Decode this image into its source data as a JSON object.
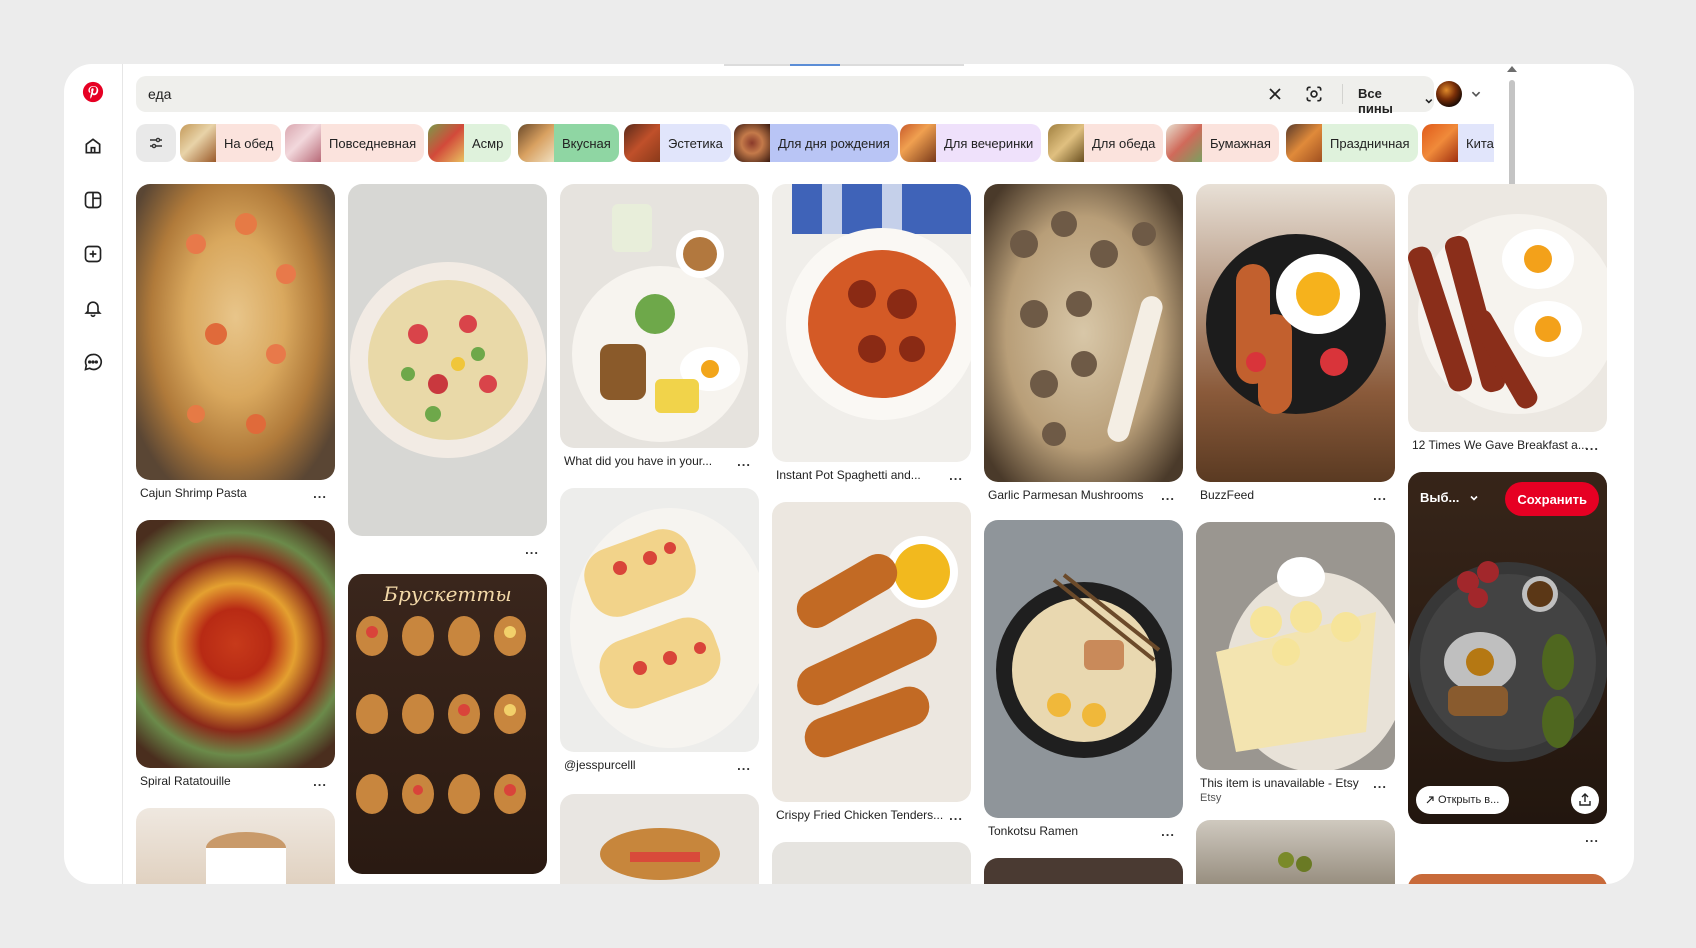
{
  "search": {
    "query": "еда",
    "filter_label": "Все пины"
  },
  "chips": [
    {
      "label": "На обед",
      "bg": "#fbe3dd"
    },
    {
      "label": "Повседневная",
      "bg": "#fbe3dd"
    },
    {
      "label": "Асмр",
      "bg": "#dff2dc"
    },
    {
      "label": "Вкусная",
      "bg": "#8fd6a3"
    },
    {
      "label": "Эстетика",
      "bg": "#e1e5fb"
    },
    {
      "label": "Для дня рождения",
      "bg": "#b9c5f5"
    },
    {
      "label": "Для вечеринки",
      "bg": "#efe1fb"
    },
    {
      "label": "Для обеда",
      "bg": "#fbe3dd"
    },
    {
      "label": "Бумажная",
      "bg": "#fbe3dd"
    },
    {
      "label": "Праздничная",
      "bg": "#dff2dc"
    },
    {
      "label": "Китай",
      "bg": "#e1e5fb"
    }
  ],
  "pins": {
    "p1": {
      "title": "Cajun Shrimp Pasta",
      "more": "..."
    },
    "p2": {
      "title": "Spiral Ratatouille",
      "more": "..."
    },
    "p4": {
      "more": "..."
    },
    "p5_image_text": "Брускетты",
    "p6": {
      "title": "What did you have in your...",
      "more": "..."
    },
    "p7": {
      "title": "@jesspurcelll",
      "more": "..."
    },
    "p9": {
      "title": "Instant Pot Spaghetti and...",
      "more": "..."
    },
    "p10": {
      "title": "Crispy Fried Chicken Tenders...",
      "more": "..."
    },
    "p12": {
      "title": "Garlic Parmesan Mushrooms",
      "more": "..."
    },
    "p13": {
      "title": "Tonkotsu Ramen",
      "more": "..."
    },
    "p15": {
      "title": "BuzzFeed",
      "more": "..."
    },
    "p16": {
      "title": "This item is unavailable - Etsy",
      "sub": "Etsy",
      "more": "..."
    },
    "p18": {
      "title": "12 Times We Gave Breakfast a...",
      "more": "..."
    },
    "p19": {
      "board": "Выб...",
      "save": "Сохранить",
      "open": "Открыть в...",
      "more": "..."
    }
  },
  "icons": [
    "pinterest-logo",
    "home-icon",
    "explore-icon",
    "create-icon",
    "bell-icon",
    "messages-icon",
    "close-icon",
    "camera-search-icon",
    "chevron-down-icon",
    "filter-sliders-icon",
    "share-icon",
    "arrow-icon"
  ],
  "colors": {
    "brand": "#e60023",
    "search_bg": "#efefec"
  }
}
